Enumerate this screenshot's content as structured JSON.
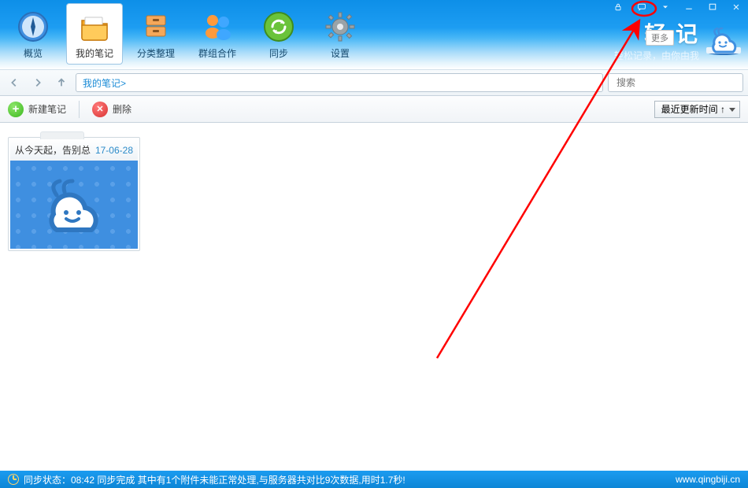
{
  "toolbar": {
    "overview": "概览",
    "my_notes": "我的笔记",
    "categories": "分类整理",
    "groups": "群组合作",
    "sync": "同步",
    "settings": "设置"
  },
  "brand": {
    "title": "轻  记",
    "subtitle": "轻松记录，由你由我",
    "more_label": "更多"
  },
  "nav": {
    "breadcrumb": "我的笔记>",
    "search_placeholder": "搜索"
  },
  "actions": {
    "new_note": "新建笔记",
    "delete": "删除",
    "sort_selected": "最近更新时间 ↑"
  },
  "notes": [
    {
      "title": "从今天起，告别总",
      "date": "17-06-28"
    }
  ],
  "status": {
    "text": "同步状态：08:42 同步完成 其中有1个附件未能正常处理,与服务器共对比9次数据,用时1.7秒!",
    "url": "www.qingbiji.cn"
  }
}
